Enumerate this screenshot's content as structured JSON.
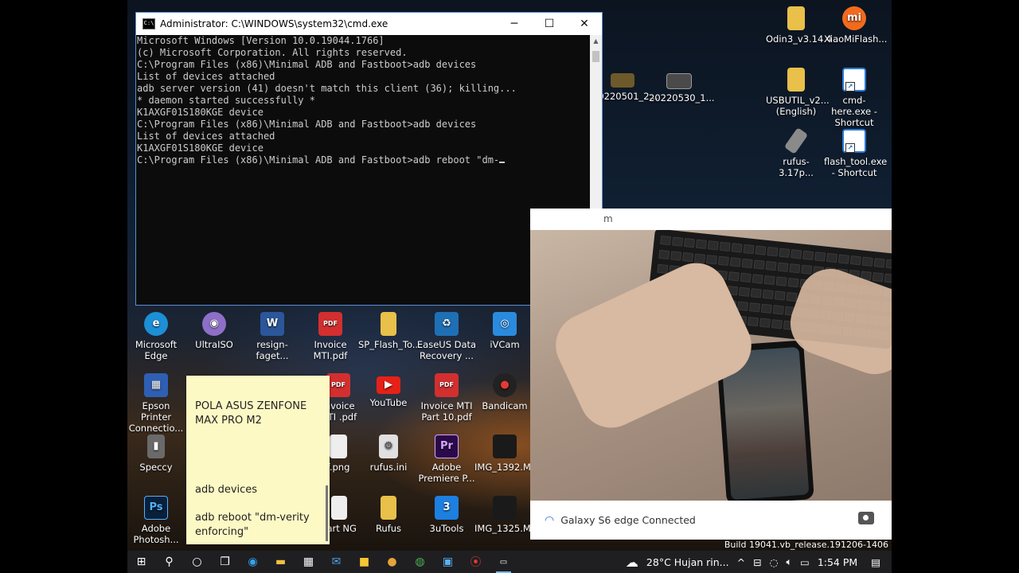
{
  "cmd": {
    "title": "Administrator: C:\\WINDOWS\\system32\\cmd.exe",
    "app_icon": "C:\\",
    "lines": [
      "Microsoft Windows [Version 10.0.19044.1766]",
      "(c) Microsoft Corporation. All rights reserved.",
      "",
      "C:\\Program Files (x86)\\Minimal ADB and Fastboot>adb devices",
      "List of devices attached",
      "adb server version (41) doesn't match this client (36); killing...",
      "* daemon started successfully *",
      "K1AXGF01S180KGE device",
      "",
      "",
      "C:\\Program Files (x86)\\Minimal ADB and Fastboot>adb devices",
      "List of devices attached",
      "K1AXGF01S180KGE device",
      "",
      ""
    ],
    "current_input": "C:\\Program Files (x86)\\Minimal ADB and Fastboot>adb reboot \"dm-"
  },
  "desktop": {
    "right_icons": [
      {
        "label": "Odin3_v3.14.4",
        "icon": "folder-icon",
        "color": "#e8c04a"
      },
      {
        "label": "XiaoMiFlash...",
        "icon": "mi-icon",
        "color": "#f26b1d"
      },
      {
        "label": "USBUTIL_v2... (English)",
        "icon": "folder-icon",
        "color": "#e8c04a"
      },
      {
        "label": "cmd-here.exe - Shortcut",
        "icon": "window-icon",
        "color": "#2b79d6"
      },
      {
        "label": "rufus-3.17p...",
        "icon": "usb-icon",
        "color": "#8a8a8a"
      },
      {
        "label": "flash_tool.exe - Shortcut",
        "icon": "window-icon",
        "color": "#2b79d6"
      },
      {
        "label": "20220501_2...",
        "icon": "image-icon",
        "color": "#6d5a2a"
      },
      {
        "label": "20220530_1...",
        "icon": "image-icon",
        "color": "#4a4a4a"
      }
    ],
    "grid_icons": [
      {
        "label": "Microsoft Edge",
        "icon": "edge-icon",
        "color": "#1c8fd6",
        "glyph": "e"
      },
      {
        "label": "UltraISO",
        "icon": "disc-icon",
        "color": "#8e6fc7",
        "glyph": "◉"
      },
      {
        "label": "resign-faget...",
        "icon": "word-icon",
        "color": "#2b579a",
        "glyph": "W"
      },
      {
        "label": "Invoice MTI.pdf",
        "icon": "pdf-icon",
        "color": "#d32f2f",
        "glyph": "PDF"
      },
      {
        "label": "SP_Flash_To...",
        "icon": "folder-icon",
        "color": "#e8c04a",
        "glyph": ""
      },
      {
        "label": "EaseUS Data Recovery ...",
        "icon": "easeus-icon",
        "color": "#1f6fb5",
        "glyph": "♻"
      },
      {
        "label": "iVCam",
        "icon": "ivcam-icon",
        "color": "#2a8bde",
        "glyph": "◎"
      },
      {
        "label": "Epson Printer Connectio...",
        "icon": "printer-icon",
        "color": "#2f5fb3",
        "glyph": "▦"
      },
      {
        "label": "Invoice MTI .pdf",
        "icon": "pdf-icon",
        "color": "#d32f2f",
        "glyph": "PDF"
      },
      {
        "label": "YouTube",
        "icon": "youtube-icon",
        "color": "#e62117",
        "glyph": "▶"
      },
      {
        "label": "Invoice MTI Part 10.pdf",
        "icon": "pdf-icon",
        "color": "#d32f2f",
        "glyph": "PDF"
      },
      {
        "label": "Bandicam",
        "icon": "bandicam-icon",
        "color": "#222222",
        "glyph": "●"
      },
      {
        "label": "Speccy",
        "icon": "speccy-icon",
        "color": "#6a6a6a",
        "glyph": "▮"
      },
      {
        "label": "f.png",
        "icon": "image-file-icon",
        "color": "#eeeeee",
        "glyph": ""
      },
      {
        "label": "rufus.ini",
        "icon": "settings-file-icon",
        "color": "#e0e0e0",
        "glyph": "⚙"
      },
      {
        "label": "Adobe Premiere P...",
        "icon": "premiere-icon",
        "color": "#2a0a4a",
        "glyph": "Pr"
      },
      {
        "label": "IMG_1392.M...",
        "icon": "video-icon",
        "color": "#1a1a1a",
        "glyph": ""
      },
      {
        "label": "Adobe Photosh...",
        "icon": "photoshop-icon",
        "color": "#0a1f3a",
        "glyph": "Ps"
      },
      {
        "label": "Part NG",
        "icon": "file-icon",
        "color": "#eeeeee",
        "glyph": ""
      },
      {
        "label": "Rufus",
        "icon": "folder-icon",
        "color": "#e8c04a",
        "glyph": ""
      },
      {
        "label": "3uTools",
        "icon": "3utools-icon",
        "color": "#1d7fe0",
        "glyph": "3"
      },
      {
        "label": "IMG_1325.M...",
        "icon": "video-icon",
        "color": "#1a1a1a",
        "glyph": ""
      }
    ]
  },
  "sticky": {
    "line1": "POLA ASUS ZENFONE",
    "line2": "MAX PRO M2",
    "line3": "adb devices",
    "line4": "adb reboot \"dm-verity",
    "line5": "enforcing\""
  },
  "camera": {
    "status": "Galaxy S6 edge Connected",
    "header_letter": "m"
  },
  "build": "Build 19041.vb_release.191206-1406",
  "taskbar": {
    "weather": "28°C  Hujan rin...",
    "time": "1:54 PM"
  }
}
